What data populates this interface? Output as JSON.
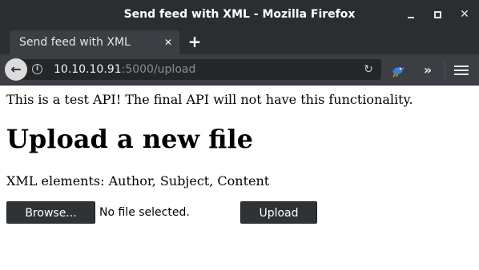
{
  "window": {
    "title": "Send feed with XML - Mozilla Firefox",
    "controls": [
      "minimize-icon",
      "maximize-icon",
      "close-icon"
    ]
  },
  "tabs": [
    {
      "label": "Send feed with XML",
      "close_glyph": "✕"
    }
  ],
  "new_tab_glyph": "+",
  "navbar": {
    "back_glyph": "←",
    "info_glyph": "i",
    "url_host": "10.10.10.91",
    "url_rest": ":5000/upload",
    "reload_glyph": "↻",
    "overflow_glyph": "»"
  },
  "page": {
    "notice": "This is a test API! The final API will not have this functionality.",
    "heading": "Upload a new file",
    "elements_text": "XML elements: Author, Subject, Content",
    "browse_label": "Browse...",
    "no_file_text": "No file selected.",
    "upload_label": "Upload"
  },
  "colors": {
    "titlebar": "#2b2e31",
    "toolbar": "#3b3f43",
    "urlbar": "#24272a",
    "button": "#2f3336"
  }
}
